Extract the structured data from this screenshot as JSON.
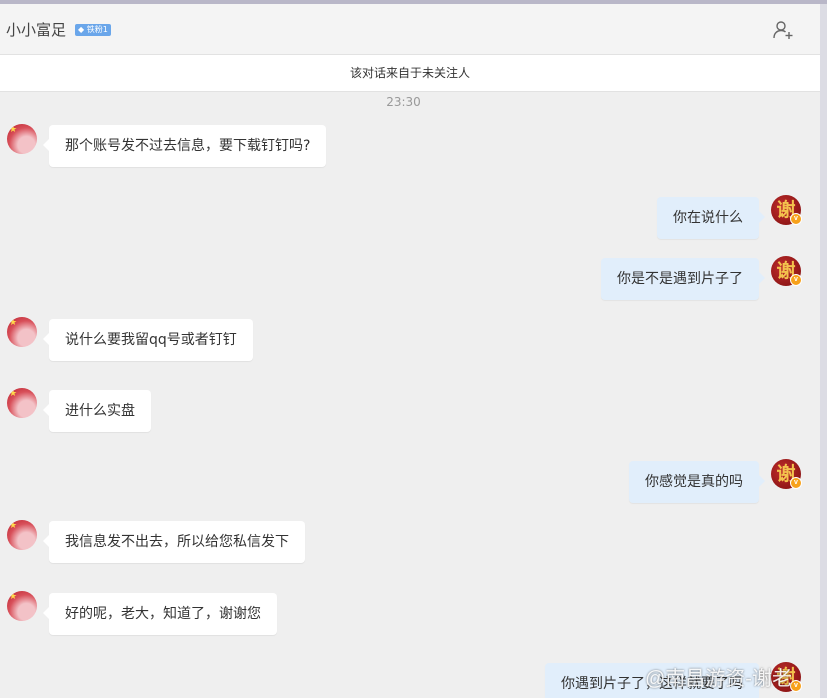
{
  "header": {
    "title": "小小富足",
    "badge": "◆ 铁粉1",
    "add_user_icon": "add-user-icon"
  },
  "notice": "该对话来自于未关注人",
  "timestamp": "23:30",
  "messages": [
    {
      "side": "in",
      "text": "那个账号发不过去信息，要下载钉钉吗?"
    },
    {
      "side": "out",
      "text": "你在说什么"
    },
    {
      "side": "out",
      "text": "你是不是遇到片子了"
    },
    {
      "side": "in",
      "text": "说什么要我留qq号或者钉钉"
    },
    {
      "side": "in",
      "text": "进什么实盘"
    },
    {
      "side": "out",
      "text": "你感觉是真的吗"
    },
    {
      "side": "in",
      "text": "我信息发不出去，所以给您私信发下"
    },
    {
      "side": "in",
      "text": "好的呢，老大，知道了，谢谢您"
    },
    {
      "side": "out",
      "text": "你遇到片子了，这样就要了吗"
    }
  ],
  "own_avatar_char": "谢",
  "own_avatar_badge": "v",
  "watermark": "@南昌游资-谢老",
  "colors": {
    "incoming_bubble": "#ffffff",
    "outgoing_bubble": "#e1eefb",
    "background": "#efefef",
    "badge": "#6aa6ea"
  }
}
